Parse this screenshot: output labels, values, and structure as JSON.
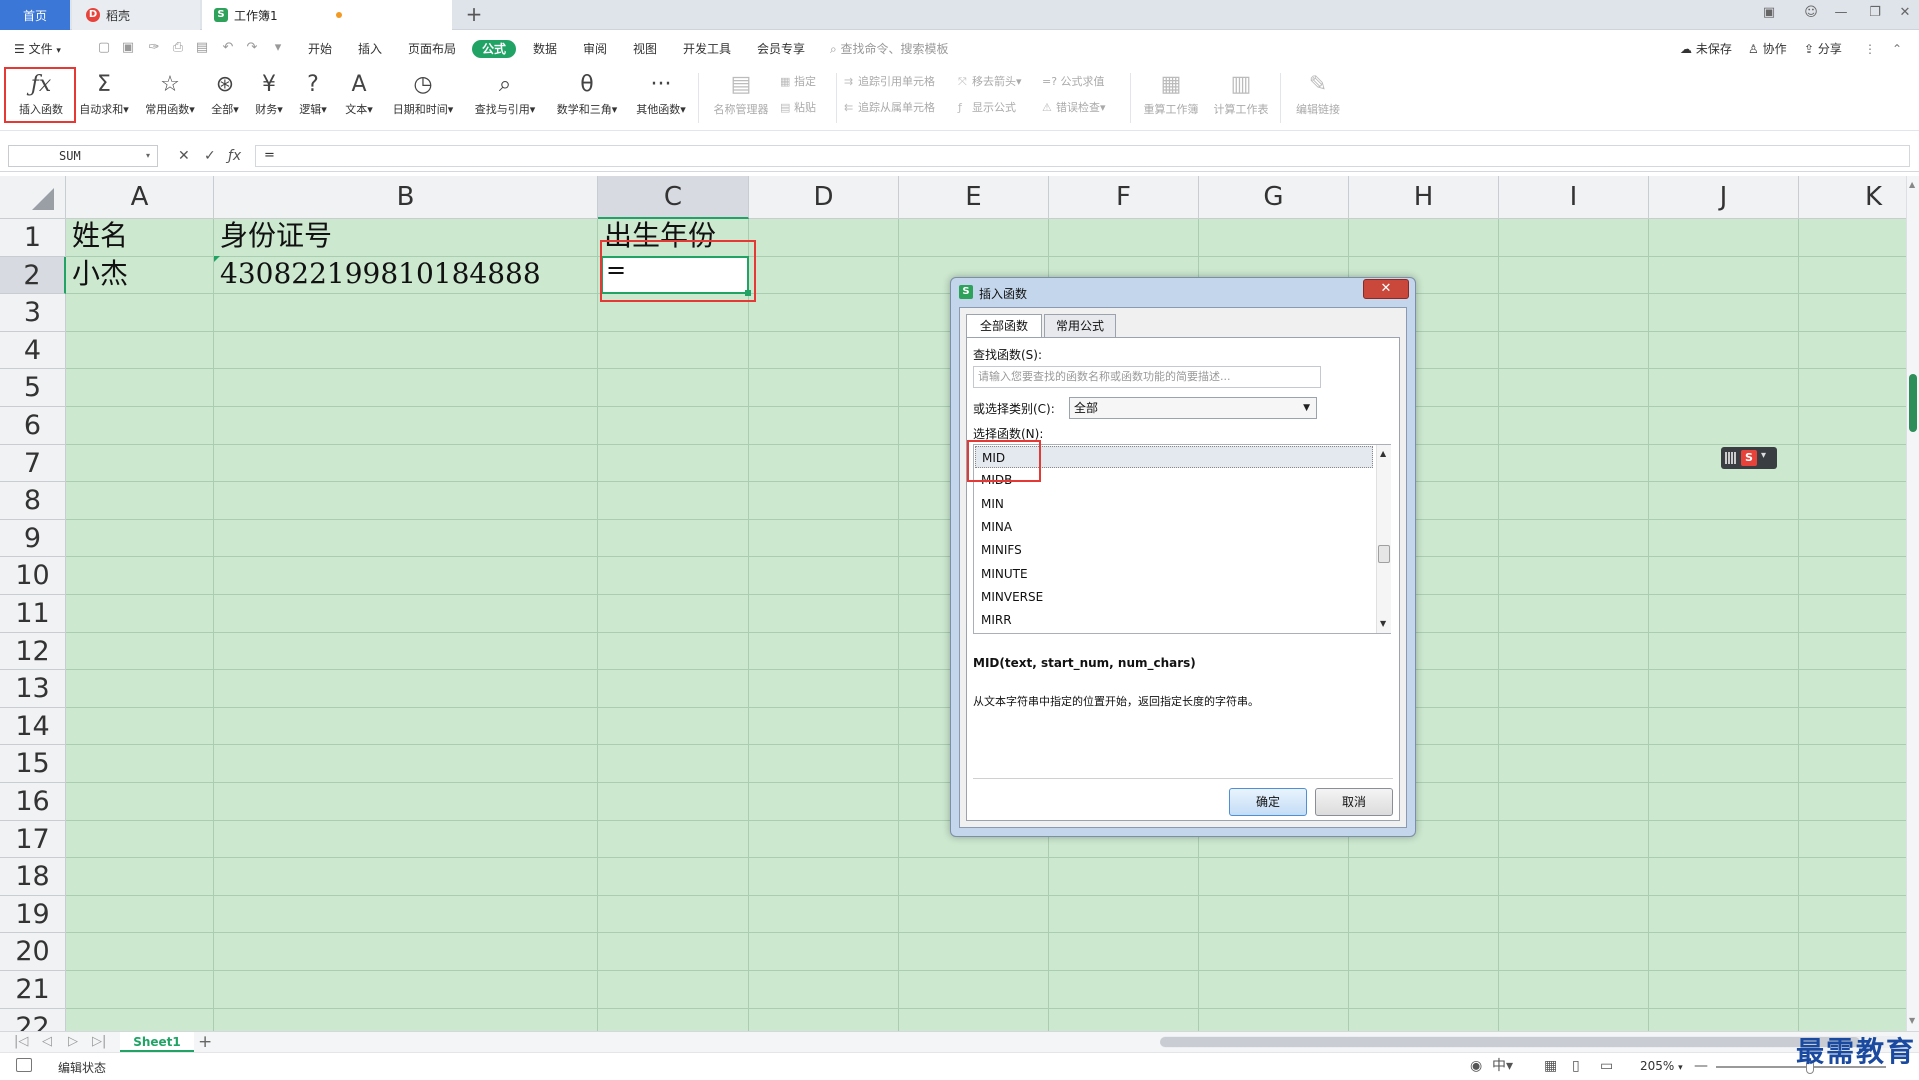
{
  "titlebar": {
    "tabs": [
      {
        "label": "首页"
      },
      {
        "label": "稻壳"
      },
      {
        "label": "工作簿1"
      }
    ],
    "new_tab": "+"
  },
  "menubar": {
    "file": "文件",
    "items": [
      "开始",
      "插入",
      "页面布局",
      "公式",
      "数据",
      "审阅",
      "视图",
      "开发工具",
      "会员专享"
    ],
    "search_placeholder": "查找命令、搜索模板",
    "right": [
      "未保存",
      "协作",
      "分享"
    ]
  },
  "ribbon": {
    "groups": [
      {
        "label": "插入函数",
        "icon": "fx-icon",
        "glyph": "ƒx"
      },
      {
        "label": "自动求和▾",
        "icon": "sigma-icon",
        "glyph": "Σ"
      },
      {
        "label": "常用函数▾",
        "icon": "star-icon",
        "glyph": "☆"
      },
      {
        "label": "全部▾",
        "icon": "asterisk-icon",
        "glyph": "⊛"
      },
      {
        "label": "财务▾",
        "icon": "yen-icon",
        "glyph": "¥"
      },
      {
        "label": "逻辑▾",
        "icon": "question-icon",
        "glyph": "?"
      },
      {
        "label": "文本▾",
        "icon": "text-icon",
        "glyph": "A"
      },
      {
        "label": "日期和时间▾",
        "icon": "clock-icon",
        "glyph": "◷"
      },
      {
        "label": "查找与引用▾",
        "icon": "lookup-icon",
        "glyph": "⌕"
      },
      {
        "label": "数学和三角▾",
        "icon": "math-icon",
        "glyph": "θ"
      },
      {
        "label": "其他函数▾",
        "icon": "more-icon",
        "glyph": "···"
      },
      {
        "label": "名称管理器",
        "icon": "name-manager-icon",
        "glyph": "▤"
      }
    ],
    "small": {
      "specify": "指定",
      "paste": "粘贴",
      "trace_precedents": "追踪引用单元格",
      "trace_dependents": "追踪从属单元格",
      "remove_arrows": "移去箭头▾",
      "show_formulas": "显示公式",
      "evaluate_formula": "=? 公式求值",
      "error_check": "错误检查▾"
    },
    "right_groups": [
      {
        "label": "重算工作簿",
        "icon": "recalc-book-icon",
        "glyph": "▦"
      },
      {
        "label": "计算工作表",
        "icon": "calc-sheet-icon",
        "glyph": "▥"
      },
      {
        "label": "编辑链接",
        "icon": "edit-link-icon",
        "glyph": "✎"
      }
    ]
  },
  "formulabar": {
    "namebox": "SUM",
    "cancel": "✕",
    "confirm": "✓",
    "fx": "ƒx",
    "content": "="
  },
  "grid": {
    "columns": [
      "A",
      "B",
      "C",
      "D",
      "E",
      "F",
      "G",
      "H",
      "I",
      "J",
      "K"
    ],
    "rows": [
      "1",
      "2",
      "3",
      "4",
      "5",
      "6",
      "7",
      "8",
      "9",
      "10",
      "11",
      "12",
      "13",
      "14",
      "15",
      "16",
      "17",
      "18",
      "19",
      "20",
      "21",
      "22"
    ],
    "cells": {
      "A1": "姓名",
      "B1": "身份证号",
      "C1": "出生年份",
      "A2": "小杰",
      "B2": "430822199810184888",
      "C2": "="
    }
  },
  "sheetbar": {
    "sheet_name": "Sheet1",
    "add": "+"
  },
  "statusbar": {
    "status": "编辑状态",
    "zoom": "205%"
  },
  "watermark": "最需教育",
  "dialog": {
    "title": "插入函数",
    "close": "✕",
    "tabs": [
      "全部函数",
      "常用公式"
    ],
    "search_label": "查找函数(S):",
    "search_placeholder": "请输入您要查找的函数名称或函数功能的简要描述...",
    "category_label": "或选择类别(C):",
    "category_value": "全部",
    "functions_label": "选择函数(N):",
    "functions": [
      "MID",
      "MIDB",
      "MIN",
      "MINA",
      "MINIFS",
      "MINUTE",
      "MINVERSE",
      "MIRR"
    ],
    "selected_function": "MID",
    "signature": "MID(text, start_num, num_chars)",
    "description": "从文本字符串中指定的位置开始，返回指定长度的字符串。",
    "ok": "确定",
    "cancel": "取消"
  }
}
